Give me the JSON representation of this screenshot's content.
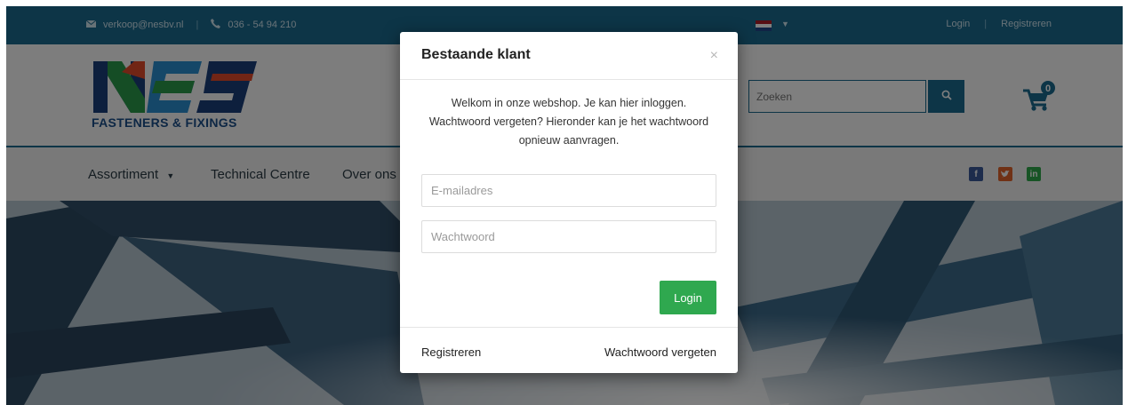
{
  "topbar": {
    "email": "verkoop@nesbv.nl",
    "phone": "036 - 54 94 210",
    "login": "Login",
    "register": "Registreren",
    "separator": "|",
    "flag_colors": [
      "#ae1c28",
      "#ffffff",
      "#21468b"
    ]
  },
  "header": {
    "logo_text": "FASTENERS & FIXINGS",
    "search_placeholder": "Zoeken",
    "cart_count": "0",
    "brand_color": "#1b6a8f"
  },
  "nav": {
    "items": [
      "Assortiment",
      "Technical Centre",
      "Over ons"
    ],
    "social_icons": [
      "facebook-icon",
      "twitter-icon",
      "linkedin-icon"
    ]
  },
  "modal": {
    "title": "Bestaande klant",
    "close": "×",
    "message": "Welkom in onze webshop. Je kan hier inloggen. Wachtwoord vergeten? Hieronder kan je het wachtwoord opnieuw aanvragen.",
    "email_placeholder": "E-mailadres",
    "password_placeholder": "Wachtwoord",
    "login_button": "Login",
    "register_link": "Registreren",
    "forgot_link": "Wachtwoord vergeten",
    "button_color": "#2fa84f"
  }
}
